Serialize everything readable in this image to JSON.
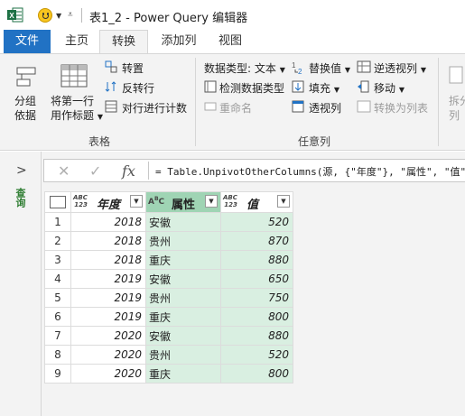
{
  "titlebar": {
    "title": "表1_2 - Power Query 编辑器"
  },
  "tabs": {
    "file": "文件",
    "home": "主页",
    "transform": "转换",
    "add_column": "添加列",
    "view": "视图"
  },
  "ribbon": {
    "table_group": {
      "label": "表格",
      "group_by": [
        "分组",
        "依据"
      ],
      "first_row_headers": [
        "将第一行",
        "用作标题"
      ],
      "transpose": "转置",
      "reverse_rows": "反转行",
      "count_rows": "对行进行计数"
    },
    "any_column_group": {
      "label": "任意列",
      "data_type": "数据类型: 文本",
      "detect_type": "检测数据类型",
      "rename": "重命名",
      "replace_values": "替换值",
      "fill": "填充",
      "pivot_column": "透视列",
      "unpivot_columns": "逆透视列",
      "move": "移动",
      "convert_to_list": "转换为列表"
    },
    "text_group": {
      "split": [
        "拆分",
        "列"
      ]
    }
  },
  "nav": {
    "queries_label": "查询"
  },
  "formula_bar": {
    "formula": "= Table.UnpivotOtherColumns(源, {\"年度\"}, \"属性\", \"值\")"
  },
  "grid": {
    "columns": [
      {
        "type": "ABC\n123",
        "name": "年度"
      },
      {
        "type": "A²C",
        "name": "属性"
      },
      {
        "type": "ABC\n123",
        "name": "值"
      }
    ],
    "rows": [
      {
        "n": "1",
        "year": "2018",
        "attr": "安徽",
        "val": "520"
      },
      {
        "n": "2",
        "year": "2018",
        "attr": "贵州",
        "val": "870"
      },
      {
        "n": "3",
        "year": "2018",
        "attr": "重庆",
        "val": "880"
      },
      {
        "n": "4",
        "year": "2019",
        "attr": "安徽",
        "val": "650"
      },
      {
        "n": "5",
        "year": "2019",
        "attr": "贵州",
        "val": "750"
      },
      {
        "n": "6",
        "year": "2019",
        "attr": "重庆",
        "val": "800"
      },
      {
        "n": "7",
        "year": "2020",
        "attr": "安徽",
        "val": "880"
      },
      {
        "n": "8",
        "year": "2020",
        "attr": "贵州",
        "val": "520"
      },
      {
        "n": "9",
        "year": "2020",
        "attr": "重庆",
        "val": "800"
      }
    ]
  },
  "colors": {
    "accent": "#2172c4",
    "selected_column": "#d9efe1",
    "selected_header": "#9fd4b4",
    "excel_green": "#1e7145"
  }
}
